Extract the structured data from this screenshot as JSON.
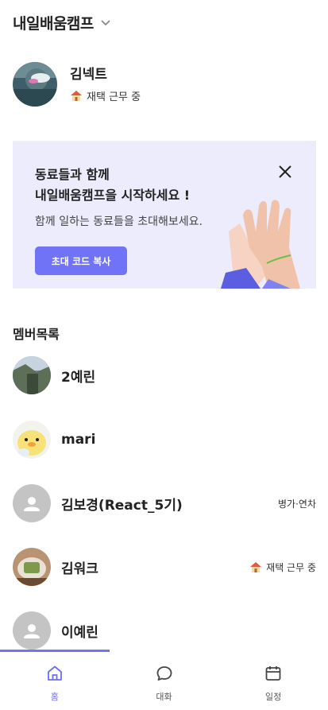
{
  "header": {
    "title": "내일배움캠프"
  },
  "profile": {
    "name": "김넥트",
    "status": "재택 근무 중"
  },
  "banner": {
    "line1": "동료들과 함께",
    "line2": "내일배움캠프을 시작하세요 !",
    "subtitle": "함께 일하는 동료들을 초대해보세요.",
    "button_label": "초대 코드 복사"
  },
  "members_section": {
    "title": "멤버목록",
    "members": [
      {
        "name": "2예린",
        "status": ""
      },
      {
        "name": "mari",
        "status": ""
      },
      {
        "name": "김보경(React_5기)",
        "status": "병가·연차"
      },
      {
        "name": "김워크",
        "status": "재택 근무 중"
      },
      {
        "name": "이예린",
        "status": ""
      }
    ]
  },
  "nav": {
    "tabs": [
      {
        "label": "홈",
        "icon": "home-icon",
        "active": true
      },
      {
        "label": "대화",
        "icon": "chat-icon",
        "active": false
      },
      {
        "label": "일정",
        "icon": "calendar-icon",
        "active": false
      }
    ]
  },
  "colors": {
    "accent": "#7173f6",
    "banner_bg": "#ececfd",
    "default_avatar": "#c4c4c4"
  }
}
